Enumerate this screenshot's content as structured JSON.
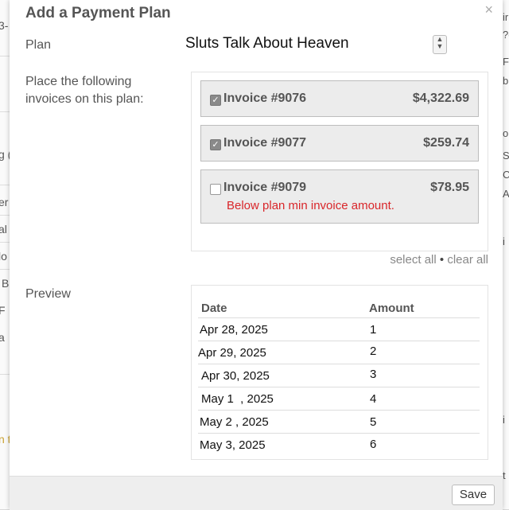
{
  "modal": {
    "title": "Add a Payment Plan",
    "close_glyph": "×"
  },
  "plan": {
    "label": "Plan",
    "value": "Sluts Talk About Heaven"
  },
  "invoices_section": {
    "label_line1": "Place the following",
    "label_line2": "invoices on this plan:",
    "invoices": [
      {
        "label": "Invoice #9076",
        "amount": "$4,322.69",
        "checked": true,
        "error": ""
      },
      {
        "label": "Invoice #9077",
        "amount": "$259.74",
        "checked": true,
        "error": ""
      },
      {
        "label": "Invoice #9079",
        "amount": "$78.95",
        "checked": false,
        "error": "Below plan min invoice amount."
      }
    ],
    "select_all": "select all",
    "separator": "•",
    "clear_all": "clear all"
  },
  "preview": {
    "label": "Preview",
    "headers": {
      "date": "Date",
      "amount": "Amount"
    },
    "rows": [
      {
        "date": "Apr 28, 2025",
        "amount": "1"
      },
      {
        "date": "Apr 29, 2025",
        "amount": "2"
      },
      {
        "date": "Apr 30, 2025",
        "amount": "3"
      },
      {
        "date": "May 1  , 2025",
        "amount": "4"
      },
      {
        "date": "May 2 , 2025",
        "amount": "5"
      },
      {
        "date": "May 3, 2025",
        "amount": "6"
      }
    ]
  },
  "footer": {
    "save_label": "Save"
  },
  "background": {
    "left_fragments": [
      "3-",
      "g (",
      "er",
      "al",
      "lo",
      "B",
      "F",
      "a",
      "n t"
    ],
    "right_fragments": [
      "ir",
      "?e",
      "F",
      "b",
      "o",
      "S",
      "C",
      "A",
      "i",
      "i",
      "t"
    ]
  },
  "colors": {
    "error": "#d9262a",
    "card_bg": "#ececec",
    "footer_bg": "#eeeeee"
  }
}
